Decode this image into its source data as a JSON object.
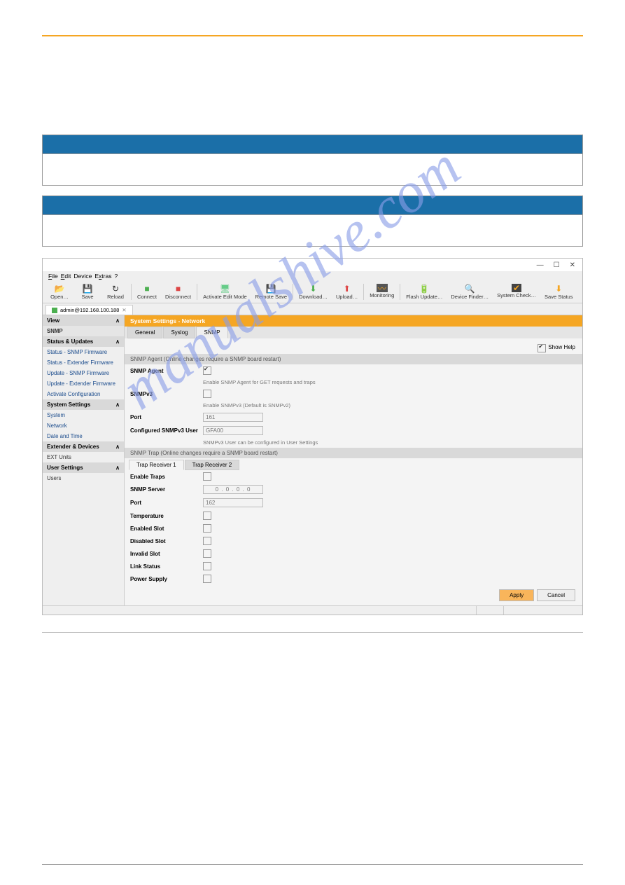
{
  "watermark": "manualshive.com",
  "window": {
    "controls": {
      "min": "—",
      "max": "☐",
      "close": "✕"
    }
  },
  "menu": {
    "file": "File",
    "edit": "Edit",
    "device": "Device",
    "extras": "Extras",
    "help": "?"
  },
  "toolbar": {
    "open": "Open…",
    "save": "Save",
    "reload": "Reload",
    "connect": "Connect",
    "disconnect": "Disconnect",
    "activate_edit": "Activate Edit Mode",
    "remote_save": "Remote Save",
    "download": "Download…",
    "upload": "Upload…",
    "monitoring": "Monitoring",
    "flash_update": "Flash Update…",
    "device_finder": "Device Finder…",
    "system_check": "System Check…",
    "save_status": "Save Status"
  },
  "doc_tab": {
    "label": "admin@192.168.100.188",
    "close": "✕"
  },
  "sidebar": {
    "view": {
      "header": "View",
      "caret": "∧",
      "items": [
        "SNMP"
      ]
    },
    "status": {
      "header": "Status & Updates",
      "caret": "∧",
      "items": [
        "Status - SNMP Firmware",
        "Status - Extender Firmware",
        "Update - SNMP Firmware",
        "Update - Extender Firmware",
        "Activate Configuration"
      ]
    },
    "system": {
      "header": "System Settings",
      "caret": "∧",
      "items": [
        "System",
        "Network",
        "Date and Time"
      ]
    },
    "ext": {
      "header": "Extender & Devices",
      "caret": "∧",
      "items": [
        "EXT Units"
      ]
    },
    "user": {
      "header": "User Settings",
      "caret": "∧",
      "items": [
        "Users"
      ]
    }
  },
  "main": {
    "title": "System Settings - Network",
    "tabs": {
      "general": "General",
      "syslog": "Syslog",
      "snmp": "SNMP"
    },
    "show_help": "Show Help",
    "agent_group_hdr": "SNMP Agent (Online changes require a SNMP board restart)",
    "agent": {
      "snmp_agent_label": "SNMP Agent",
      "snmp_agent_hint": "Enable SNMP Agent for GET requests and traps",
      "snmpv3_label": "SNMPv3",
      "snmpv3_hint": "Enable SNMPv3 (Default is SNMPv2)",
      "port_label": "Port",
      "port_value": "161",
      "user_label": "Configured SNMPv3 User",
      "user_value": "GFA00",
      "user_hint": "SNMPv3 User can be configured in User Settings"
    },
    "trap_group_hdr": "SNMP Trap (Online changes require a SNMP board restart)",
    "trap_tabs": {
      "r1": "Trap Receiver 1",
      "r2": "Trap Receiver 2"
    },
    "trap": {
      "enable_traps": "Enable Traps",
      "server_label": "SNMP Server",
      "server_value": "0 . 0 . 0 . 0",
      "port_label": "Port",
      "port_value": "162",
      "temperature": "Temperature",
      "enabled_slot": "Enabled Slot",
      "disabled_slot": "Disabled Slot",
      "invalid_slot": "Invalid Slot",
      "link_status": "Link Status",
      "power_supply": "Power Supply"
    },
    "buttons": {
      "apply": "Apply",
      "cancel": "Cancel"
    }
  }
}
